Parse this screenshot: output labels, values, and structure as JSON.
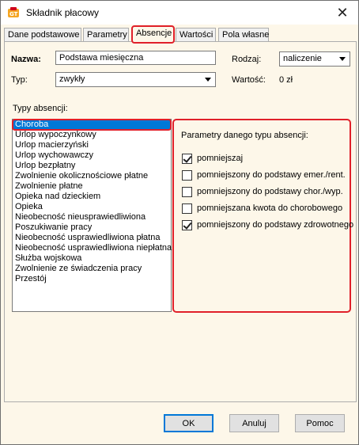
{
  "window": {
    "title": "Składnik płacowy",
    "close_symbol": "✕"
  },
  "tabs": [
    {
      "label": "Dane podstawowe",
      "active": false
    },
    {
      "label": "Parametry",
      "active": false
    },
    {
      "label": "Absencje",
      "active": true
    },
    {
      "label": "Wartości",
      "active": false
    },
    {
      "label": "Pola własne",
      "active": false
    }
  ],
  "form": {
    "name_label": "Nazwa:",
    "name_value": "Podstawa miesięczna",
    "type_label": "Typ:",
    "type_value": "zwykły",
    "kind_label": "Rodzaj:",
    "kind_value": "naliczenie",
    "value_label": "Wartość:",
    "value_value": "0 zł"
  },
  "absence_types": {
    "label": "Typy absencji:",
    "selected_index": 0,
    "items": [
      "Choroba",
      "Urlop wypoczynkowy",
      "Urlop macierzyński",
      "Urlop wychowawczy",
      "Urlop bezpłatny",
      "Zwolnienie okolicznościowe płatne",
      "Zwolnienie płatne",
      "Opieka nad dzieckiem",
      "Opieka",
      "Nieobecność nieusprawiedliwiona",
      "Poszukiwanie pracy",
      "Nieobecność usprawiedliwiona płatna",
      "Nieobecność usprawiedliwiona niepłatna",
      "Służba wojskowa",
      "Zwolnienie ze świadczenia pracy",
      "Przestój"
    ]
  },
  "parameters": {
    "title": "Parametry danego typu absencji:",
    "checkboxes": [
      {
        "label": "pomniejszaj",
        "checked": true
      },
      {
        "label": "pomniejszony do podstawy emer./rent.",
        "checked": false
      },
      {
        "label": "pomniejszony do podstawy chor./wyp.",
        "checked": false
      },
      {
        "label": "pomniejszana kwota do chorobowego",
        "checked": false
      },
      {
        "label": "pomniejszony do podstawy zdrowotnego",
        "checked": true
      }
    ]
  },
  "buttons": {
    "ok": "OK",
    "cancel": "Anuluj",
    "help": "Pomoc"
  },
  "colors": {
    "highlight": "#e0202a",
    "selection": "#0078d7",
    "panel_bg": "#fdf7e9"
  }
}
